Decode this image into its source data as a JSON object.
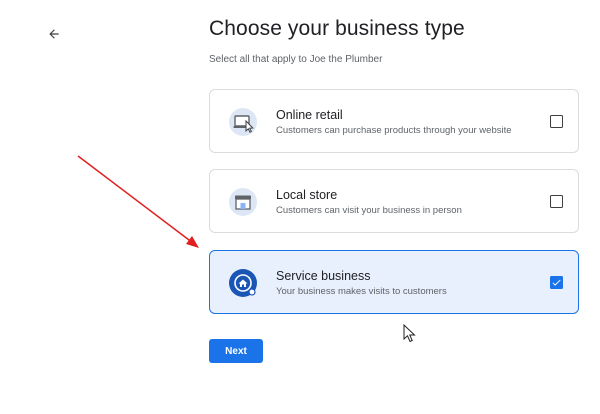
{
  "header": {
    "title": "Choose your business type",
    "subtitle": "Select all that apply to Joe the Plumber"
  },
  "options": [
    {
      "title": "Online retail",
      "description": "Customers can purchase products through your website",
      "icon": "online-retail-icon",
      "checked": false
    },
    {
      "title": "Local store",
      "description": "Customers can visit your business in person",
      "icon": "storefront-icon",
      "checked": false
    },
    {
      "title": "Service business",
      "description": "Your business makes visits to customers",
      "icon": "service-home-icon",
      "checked": true
    }
  ],
  "next_label": "Next",
  "colors": {
    "accent": "#1a73e8",
    "selected_bg": "#e8f0fe",
    "annotation": "#e02020"
  }
}
